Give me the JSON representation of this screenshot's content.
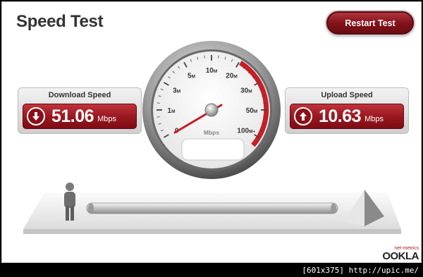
{
  "header": {
    "title": "Speed Test",
    "restart_label": "Restart Test"
  },
  "download": {
    "label": "Download Speed",
    "value": "51.06",
    "unit": "Mbps"
  },
  "upload": {
    "label": "Upload Speed",
    "value": "10.63",
    "unit": "Mbps"
  },
  "gauge": {
    "unit": "Mbps",
    "ticks": [
      {
        "label": "0",
        "sub": ""
      },
      {
        "label": "1",
        "sub": "M"
      },
      {
        "label": "3",
        "sub": "M"
      },
      {
        "label": "5",
        "sub": "M"
      },
      {
        "label": "10",
        "sub": "M"
      },
      {
        "label": "20",
        "sub": "M"
      },
      {
        "label": "30",
        "sub": "M"
      },
      {
        "label": "50",
        "sub": "M"
      },
      {
        "label": "100",
        "sub": "M+"
      }
    ]
  },
  "branding": {
    "top": "net-metrics",
    "name": "OOKLA"
  },
  "footer": {
    "caption": "[601x375] http://upic.me/"
  }
}
